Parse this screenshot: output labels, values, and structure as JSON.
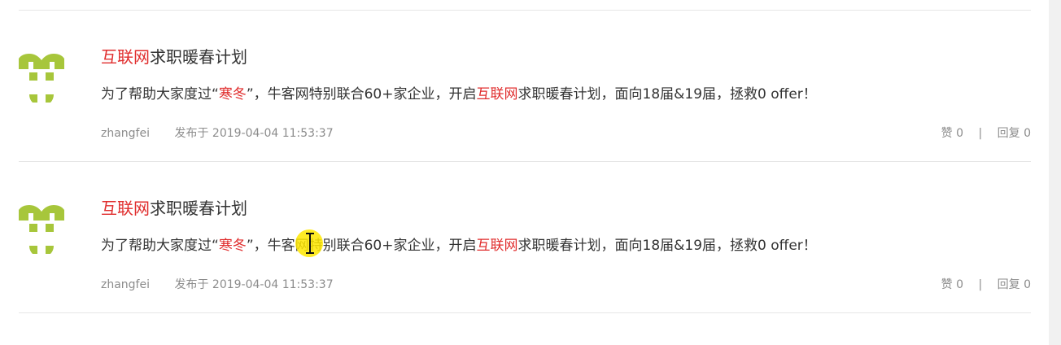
{
  "colors": {
    "accent": "#e02d2d",
    "avatar_green": "#a7c63b",
    "divider": "#e6e6e6",
    "meta_gray": "#8c8c8c"
  },
  "posts": [
    {
      "avatar_icon": "niuke-logo-icon",
      "title": {
        "highlight": "互联网",
        "rest": "求职暖春计划"
      },
      "excerpt": {
        "p1": "为了帮助大家度过“",
        "h1": "寒冬",
        "p2": "”，牛客网特别联合60+家企业，开启",
        "h2": "互联网",
        "p3": "求职暖春计划，面向18届&19届，拯救0 offer！"
      },
      "author": "zhangfei",
      "posted_label": "发布于",
      "posted_time": "2019-04-04 11:53:37",
      "likes_label": "赞",
      "likes": "0",
      "separator": "|",
      "replies_label": "回复",
      "replies": "0"
    },
    {
      "avatar_icon": "niuke-logo-icon",
      "title": {
        "highlight": "互联网",
        "rest": "求职暖春计划"
      },
      "excerpt": {
        "p1": "为了帮助大家度过“",
        "h1": "寒冬",
        "p2": "”，牛客网特别联合60+家企业，开启",
        "h2": "互联网",
        "p3": "求职暖春计划，面向18届&19届，拯救0 offer！"
      },
      "author": "zhangfei",
      "posted_label": "发布于",
      "posted_time": "2019-04-04 11:53:37",
      "likes_label": "赞",
      "likes": "0",
      "separator": "|",
      "replies_label": "回复",
      "replies": "0"
    }
  ]
}
